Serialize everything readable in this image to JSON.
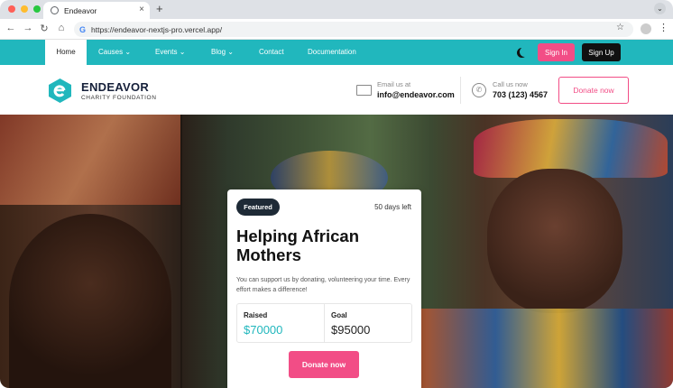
{
  "browser": {
    "tab_title": "Endeavor",
    "new_tab": "+",
    "url": "https://endeavor-nextjs-pro.vercel.app/",
    "dot_colors": [
      "#ff5f57",
      "#febc2e",
      "#28c840"
    ]
  },
  "nav": {
    "items": [
      {
        "label": "Home",
        "active": true
      },
      {
        "label": "Causes",
        "dropdown": true
      },
      {
        "label": "Events",
        "dropdown": true
      },
      {
        "label": "Blog",
        "dropdown": true
      },
      {
        "label": "Contact"
      },
      {
        "label": "Documentation"
      }
    ],
    "sign_in": "Sign In",
    "sign_up": "Sign Up",
    "accent": "#21b7bd",
    "pink": "#f24d86"
  },
  "header": {
    "brand": "ENDEAVOR",
    "brand_sub": "CHARITY FOUNDATION",
    "email_label": "Email us at",
    "email": "info@endeavor.com",
    "phone_label": "Call us now",
    "phone": "703 (123) 4567",
    "donate": "Donate now"
  },
  "card": {
    "badge": "Featured",
    "days_left": "50 days left",
    "title": "Helping African Mothers",
    "description": "You can support us by donating, volunteering your time. Every effort makes a difference!",
    "raised_label": "Raised",
    "raised_value": "$70000",
    "goal_label": "Goal",
    "goal_value": "$95000",
    "donate": "Donate now"
  }
}
